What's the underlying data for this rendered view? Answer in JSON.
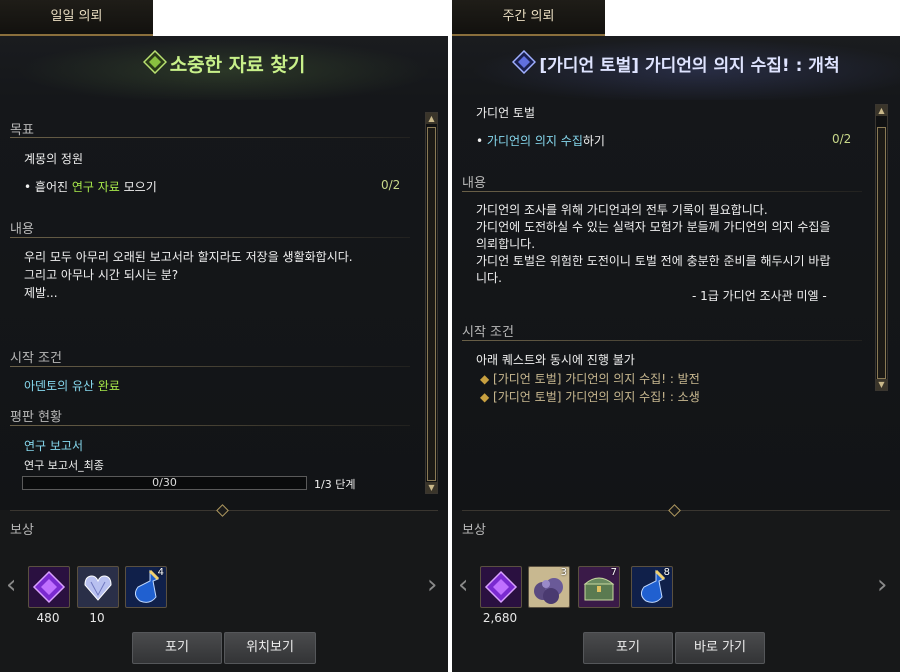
{
  "left": {
    "tab": "일일 의뢰",
    "title": "소중한 자료 찾기",
    "goal_header": "목표",
    "goal_name": "계몽의 정원",
    "goal_item_pre": "흩어진 ",
    "goal_item_hl": "연구 자료",
    "goal_item_post": " 모으기",
    "goal_count": "0/2",
    "content_header": "내용",
    "content_lines": [
      "우리 모두 아무리 오래된 보고서라 할지라도 저장을 생활화합시다.",
      "그리고 아무나 시간 되시는 분?",
      "제발..."
    ],
    "start_header": "시작 조건",
    "start_cond_hl": "아덴토의 유산",
    "start_cond_post": " 완료",
    "rep_header": "평판 현황",
    "rep_title": "연구 보고서",
    "rep_sub": "연구 보고서_최종",
    "rep_progress_label": "0/30",
    "rep_progress_fraction": 0,
    "rep_stage": "1/3 단계",
    "reward_header": "보상",
    "rewards": [
      {
        "icon": "purple-gem-icon",
        "qty": "480",
        "badge": ""
      },
      {
        "icon": "diamond-heart-icon",
        "qty": "10",
        "badge": ""
      },
      {
        "icon": "potion-icon",
        "qty": "",
        "badge": "4"
      }
    ],
    "btn_give_up": "포기",
    "btn_location": "위치보기"
  },
  "right": {
    "tab": "주간 의뢰",
    "title": "[가디언 토벌] 가디언의 의지 수집! : 개척",
    "goal_name": "가디언 토벌",
    "goal_item_hl": "가디언의 의지 수집",
    "goal_item_post": "하기",
    "goal_count": "0/2",
    "content_header": "내용",
    "content_lines": [
      "가디언의 조사를 위해 가디언과의 전투 기록이 필요합니다.",
      "가디언에 도전하실 수 있는 실력자 모험가 분들께 가디언의 의지 수집을",
      "의뢰합니다.",
      "가디언 토벌은 위험한 도전이니 토벌 전에 충분한 준비를 해두시기 바랍",
      "니다."
    ],
    "signature": "- 1급 가디언 조사관 미엘 -",
    "start_header": "시작 조건",
    "start_note": "아래 퀘스트와 동시에 진행 불가",
    "start_items": [
      "[가디언 토벌] 가디언의 의지 수집! : 발전",
      "[가디언 토벌] 가디언의 의지 수집! : 소생"
    ],
    "reward_header": "보상",
    "rewards": [
      {
        "icon": "purple-gem-icon",
        "qty": "2,680",
        "badge": ""
      },
      {
        "icon": "ore-pile-icon",
        "qty": "",
        "badge": "3"
      },
      {
        "icon": "treasure-chest-icon",
        "qty": "",
        "badge": "7"
      },
      {
        "icon": "potion-icon",
        "qty": "",
        "badge": "8"
      }
    ],
    "btn_give_up": "포기",
    "btn_go": "바로 가기"
  }
}
